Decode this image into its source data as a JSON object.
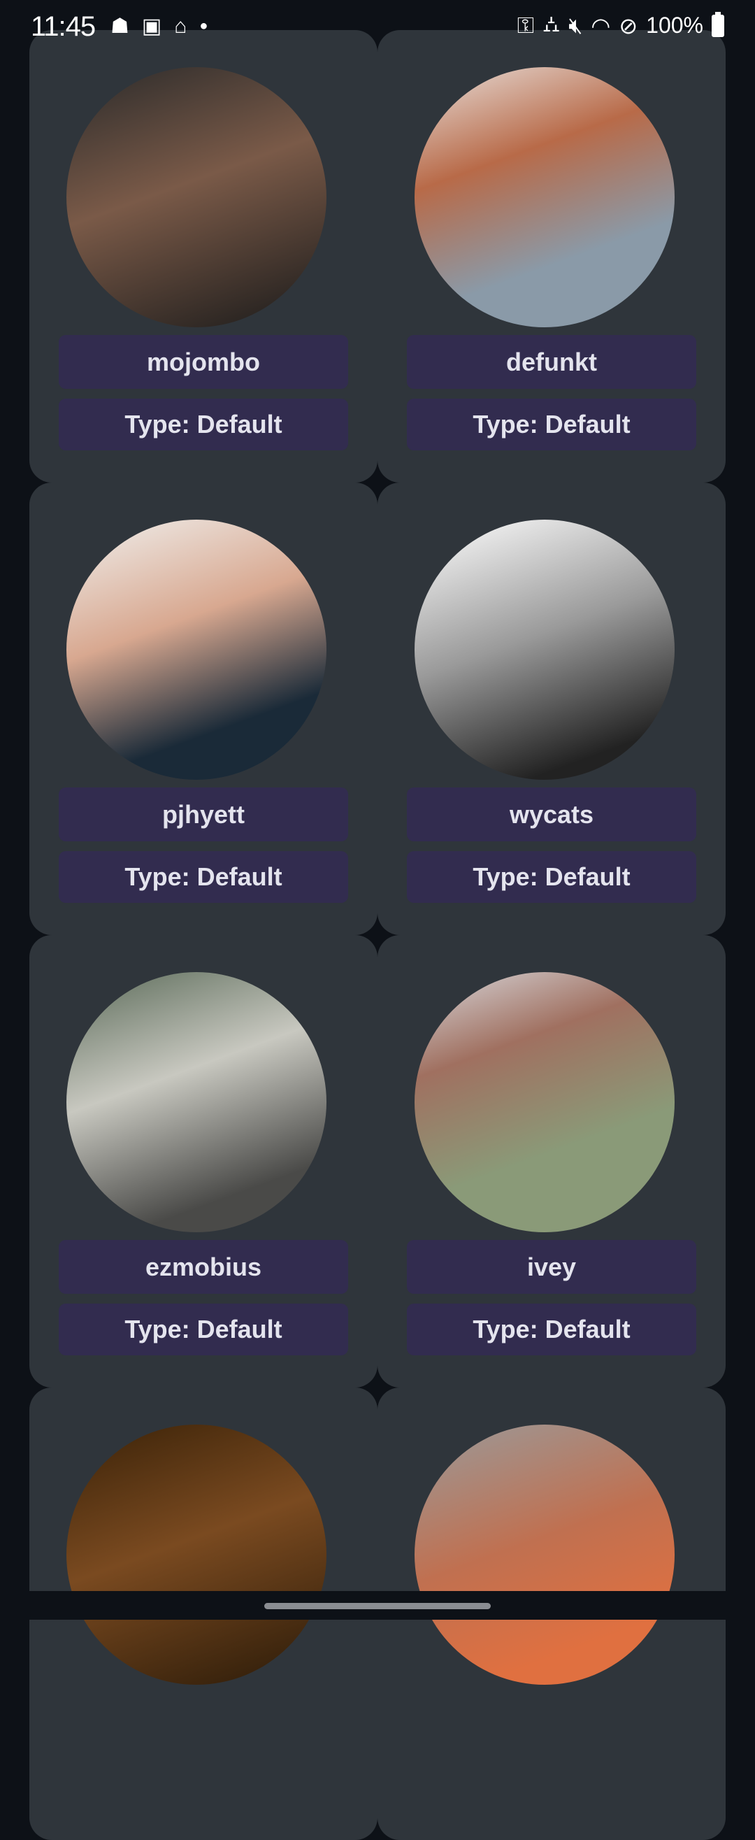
{
  "status_bar": {
    "time": "11:45",
    "left_icons": [
      "notification-icon",
      "app-k-icon",
      "mosque-icon",
      "dot-icon"
    ],
    "right_icons": [
      "vpn-key-icon",
      "sleep-mode-icon",
      "mute-icon",
      "wifi-icon",
      "do-not-disturb-icon"
    ],
    "battery": "100%"
  },
  "colors": {
    "background": "#0d1117",
    "card": "#2f353b",
    "label_bg": "#322c4f",
    "label_text": "#e4e4ee"
  },
  "users": [
    {
      "name": "mojombo",
      "type": "Type: Default",
      "avatar": "linear-gradient(160deg,#2a2a2a,#7a5a48 45%,#1a1a1a)"
    },
    {
      "name": "defunkt",
      "type": "Type: Default",
      "avatar": "linear-gradient(160deg,#e8e0dc,#b86a48 35%,#8a9aa8 70%)"
    },
    {
      "name": "pjhyett",
      "type": "Type: Default",
      "avatar": "linear-gradient(160deg,#f0f0ee,#d8a890 40%,#1a2a38 75%)"
    },
    {
      "name": "wycats",
      "type": "Type: Default",
      "avatar": "linear-gradient(160deg,#ffffff,#9a9a9a 45%,#222 85%)"
    },
    {
      "name": "ezmobius",
      "type": "Type: Default",
      "avatar": "linear-gradient(160deg,#5a6a58,#c8c8c0 40%,#4a4a48 80%)"
    },
    {
      "name": "ivey",
      "type": "Type: Default",
      "avatar": "linear-gradient(160deg,#d8d8dc,#a07060 30%,#8a9a78 65%)"
    },
    {
      "name": "",
      "type": "",
      "avatar": "linear-gradient(160deg,#3a2208,#7a4a20 45%,#2a1a08)"
    },
    {
      "name": "",
      "type": "",
      "avatar": "linear-gradient(160deg,#9a9a9a,#c07050 45%,#e07040 80%)"
    }
  ]
}
